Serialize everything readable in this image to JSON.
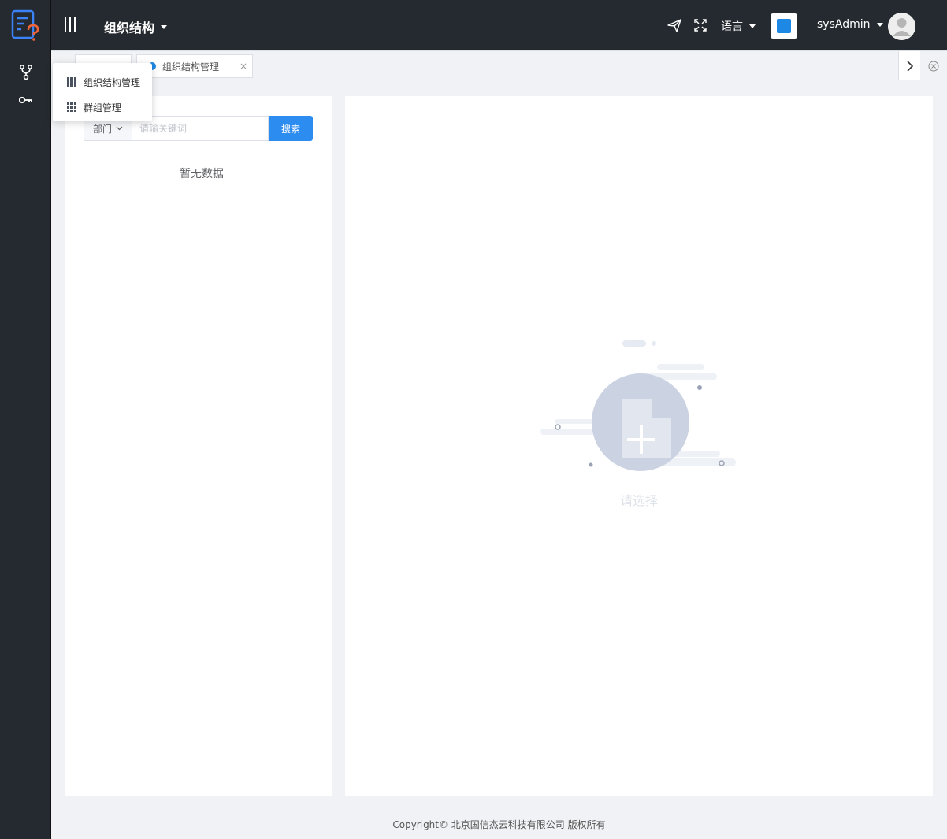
{
  "header": {
    "module_title": "组织结构",
    "language_label": "语言",
    "username": "sysAdmin",
    "theme_color": "#1e88e5"
  },
  "sidebar": {
    "icons": [
      "logo-icon",
      "org-structure-icon",
      "key-icon"
    ]
  },
  "flyout": {
    "items": [
      {
        "label": "组织结构管理",
        "icon": "grid-icon"
      },
      {
        "label": "群组管理",
        "icon": "grid-icon"
      }
    ]
  },
  "tabs": {
    "active_label": "组织结构管理",
    "close_symbol": "×"
  },
  "left_panel": {
    "filter_label": "部门",
    "search_placeholder": "请输关键词",
    "search_button": "搜索",
    "empty_text": "暂无数据"
  },
  "right_panel": {
    "empty_text": "请选择"
  },
  "footer": {
    "copyright": "Copyright© 北京国信杰云科技有限公司 版权所有"
  },
  "colors": {
    "dark_bg": "#252a30",
    "accent": "#2d8cf0",
    "page_bg": "#f0f2f5"
  }
}
